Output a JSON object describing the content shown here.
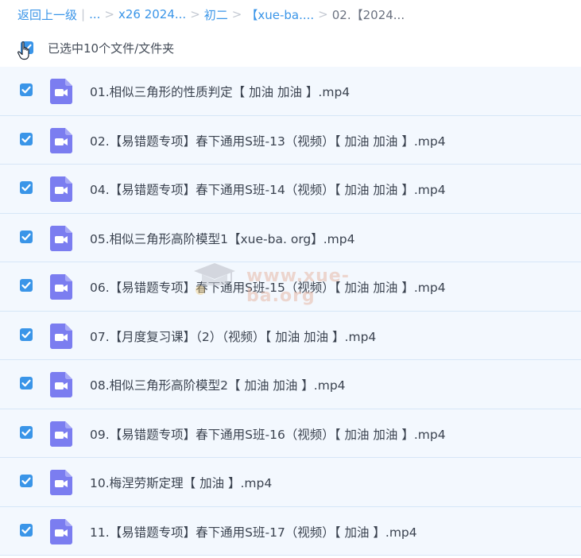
{
  "breadcrumb": {
    "back": "返回上一级",
    "sep_bar": "|",
    "items": [
      "...",
      "x26 2024...",
      "初二",
      "【xue-ba....",
      "02.【2024..."
    ],
    "sep": ">"
  },
  "selection": {
    "text": "已选中10个文件/文件夹"
  },
  "files": [
    {
      "name": "01.相似三角形的性质判定【 加油 加油 】.mp4"
    },
    {
      "name": "02.【易错题专项】春下通用S班-13（视频）【 加油 加油 】.mp4"
    },
    {
      "name": "04.【易错题专项】春下通用S班-14（视频）【 加油 加油 】.mp4"
    },
    {
      "name": "05.相似三角形高阶模型1【xue-ba. org】.mp4"
    },
    {
      "name": "06.【易错题专项】春下通用S班-15（视频）【 加油 加油 】.mp4"
    },
    {
      "name": "07.【月度复习课】（2）（视频）【 加油 加油 】.mp4"
    },
    {
      "name": "08.相似三角形高阶模型2【 加油 加油 】.mp4"
    },
    {
      "name": "09.【易错题专项】春下通用S班-16（视频）【 加油 加油 】.mp4"
    },
    {
      "name": "10.梅涅劳斯定理【 加油 】.mp4"
    },
    {
      "name": "11.【易错题专项】春下通用S班-17（视频）【 加油 】.mp4"
    }
  ],
  "watermark": {
    "text": "www.xue-ba.org"
  },
  "colors": {
    "accent": "#3a95e8",
    "row_bg": "#f3f8fe",
    "video_icon": "#7b7df0"
  }
}
